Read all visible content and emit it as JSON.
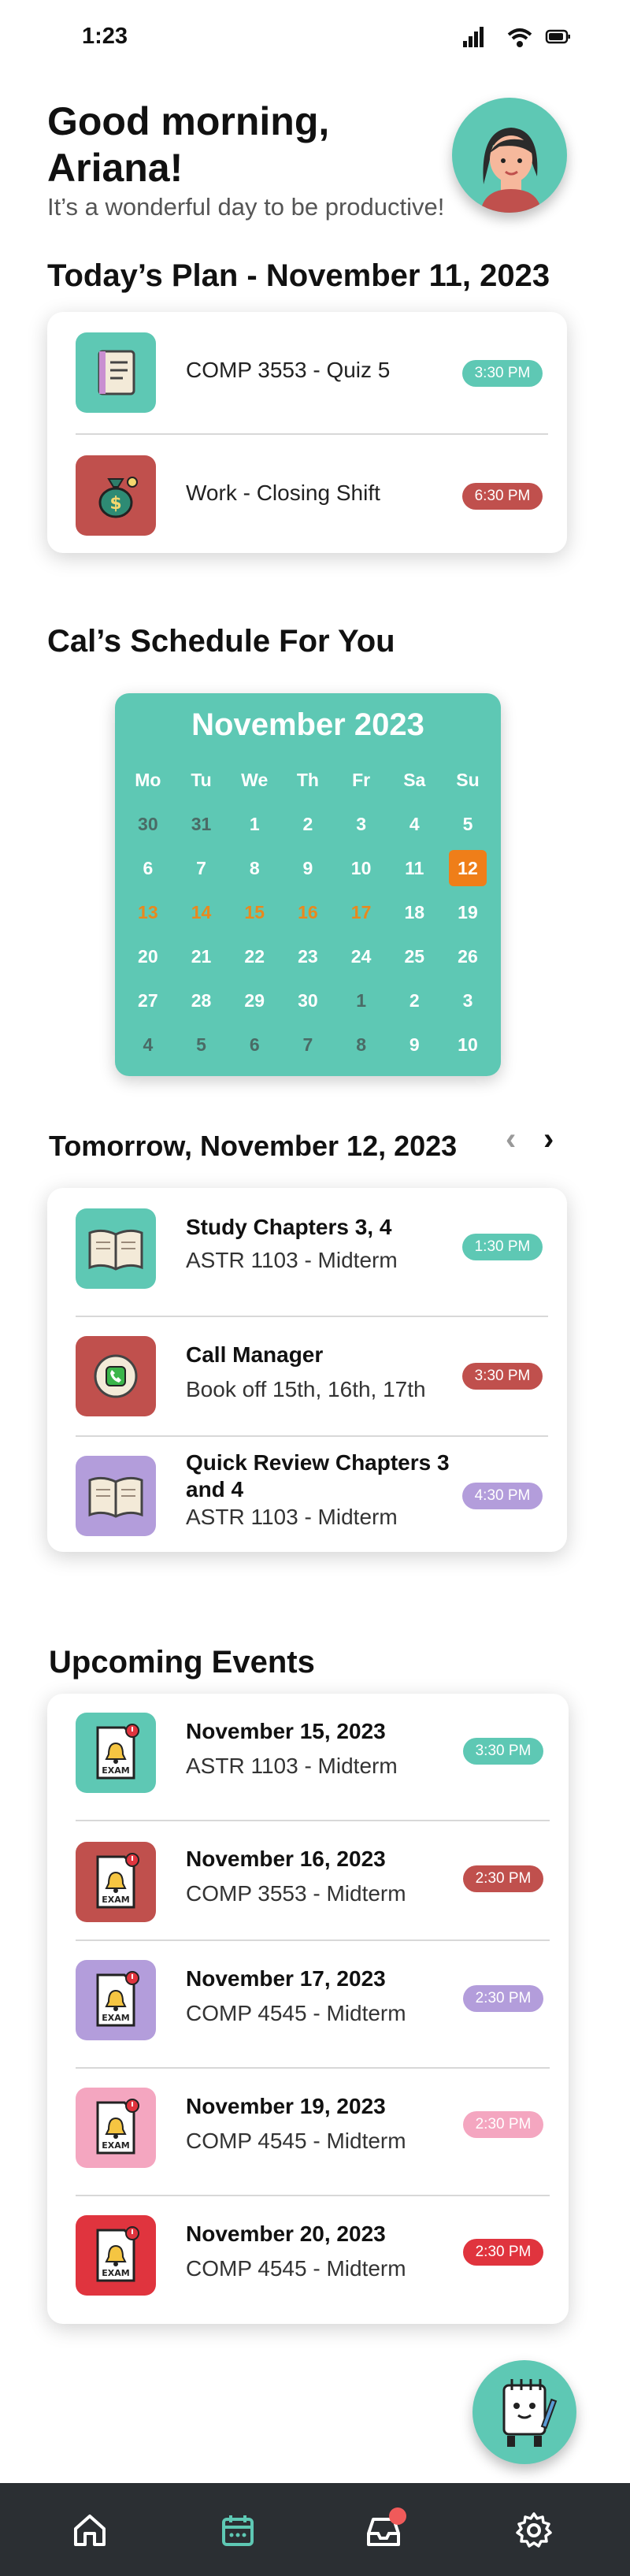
{
  "status": {
    "time": "1:23"
  },
  "greeting": {
    "title": "Good morning, Ariana!",
    "subtitle": "It’s a wonderful day to be productive!"
  },
  "today": {
    "heading": "Today’s Plan - November 11, 2023",
    "items": [
      {
        "label": "COMP 3553 - Quiz 5",
        "time": "3:30 PM",
        "color": "#5ec8b4",
        "icon": "notebook-icon"
      },
      {
        "label": "Work - Closing Shift",
        "time": "6:30 PM",
        "color": "#c0504d",
        "icon": "money-bag-icon"
      }
    ]
  },
  "calendar": {
    "heading": "Cal’s Schedule For You",
    "month": "November 2023",
    "days": [
      "Mo",
      "Tu",
      "We",
      "Th",
      "Fr",
      "Sa",
      "Su"
    ],
    "weeks": [
      [
        {
          "d": "30",
          "s": "muted"
        },
        {
          "d": "31",
          "s": "muted"
        },
        {
          "d": "1",
          "s": ""
        },
        {
          "d": "2",
          "s": ""
        },
        {
          "d": "3",
          "s": ""
        },
        {
          "d": "4",
          "s": ""
        },
        {
          "d": "5",
          "s": ""
        }
      ],
      [
        {
          "d": "6",
          "s": ""
        },
        {
          "d": "7",
          "s": ""
        },
        {
          "d": "8",
          "s": ""
        },
        {
          "d": "9",
          "s": ""
        },
        {
          "d": "10",
          "s": ""
        },
        {
          "d": "11",
          "s": ""
        },
        {
          "d": "12",
          "s": "today"
        }
      ],
      [
        {
          "d": "13",
          "s": "orange"
        },
        {
          "d": "14",
          "s": "orange"
        },
        {
          "d": "15",
          "s": "orange"
        },
        {
          "d": "16",
          "s": "orange"
        },
        {
          "d": "17",
          "s": "orange"
        },
        {
          "d": "18",
          "s": ""
        },
        {
          "d": "19",
          "s": ""
        }
      ],
      [
        {
          "d": "20",
          "s": ""
        },
        {
          "d": "21",
          "s": ""
        },
        {
          "d": "22",
          "s": ""
        },
        {
          "d": "23",
          "s": ""
        },
        {
          "d": "24",
          "s": ""
        },
        {
          "d": "25",
          "s": ""
        },
        {
          "d": "26",
          "s": ""
        }
      ],
      [
        {
          "d": "27",
          "s": ""
        },
        {
          "d": "28",
          "s": ""
        },
        {
          "d": "29",
          "s": ""
        },
        {
          "d": "30",
          "s": ""
        },
        {
          "d": "1",
          "s": "muted"
        },
        {
          "d": "2",
          "s": ""
        },
        {
          "d": "3",
          "s": ""
        }
      ],
      [
        {
          "d": "4",
          "s": "muted"
        },
        {
          "d": "5",
          "s": "muted"
        },
        {
          "d": "6",
          "s": "muted"
        },
        {
          "d": "7",
          "s": "muted"
        },
        {
          "d": "8",
          "s": "muted"
        },
        {
          "d": "9",
          "s": ""
        },
        {
          "d": "10",
          "s": ""
        }
      ]
    ],
    "colors": {
      "bg": "#5ec8b4",
      "today": "#ef7e19",
      "highlight": "#e8891e"
    }
  },
  "tomorrow": {
    "heading": "Tomorrow, November 12, 2023",
    "prev": "‹",
    "next": "›",
    "items": [
      {
        "title": "Study Chapters 3, 4",
        "sub": "ASTR 1103 - Midterm",
        "time": "1:30 PM",
        "color": "#5ec8b4",
        "icon": "open-book-icon"
      },
      {
        "title": "Call Manager",
        "sub": "Book off 15th, 16th, 17th",
        "time": "3:30 PM",
        "color": "#c0504d",
        "icon": "phone-icon"
      },
      {
        "title": "Quick Review Chapters 3 and 4",
        "sub": "ASTR 1103 - Midterm",
        "time": "4:30 PM",
        "color": "#b39ddb",
        "icon": "open-book-icon"
      }
    ]
  },
  "upcoming": {
    "heading": "Upcoming Events",
    "items": [
      {
        "date": "November 15, 2023",
        "sub": "ASTR 1103 - Midterm",
        "time": "3:30 PM",
        "color": "#5ec8b4",
        "badge": "EXAM"
      },
      {
        "date": "November 16, 2023",
        "sub": "COMP 3553 - Midterm",
        "time": "2:30 PM",
        "color": "#c0504d",
        "badge": "EXAM"
      },
      {
        "date": "November 17, 2023",
        "sub": "COMP 4545 - Midterm",
        "time": "2:30 PM",
        "color": "#b39ddb",
        "badge": "EXAM"
      },
      {
        "date": "November 19, 2023",
        "sub": "COMP 4545 - Midterm",
        "time": "2:30 PM",
        "color": "#f4a6c0",
        "badge": "EXAM"
      },
      {
        "date": "November 20, 2023",
        "sub": "COMP 4545 - Midterm",
        "time": "2:30 PM",
        "color": "#e0343e",
        "badge": "EXAM"
      }
    ]
  },
  "nav": {
    "items": [
      {
        "icon": "home-icon"
      },
      {
        "icon": "calendar-icon"
      },
      {
        "icon": "inbox-icon"
      },
      {
        "icon": "settings-icon"
      }
    ],
    "active": 1,
    "colors": {
      "bg": "#2b2f33",
      "active": "#5ec8b4",
      "icon": "#ffffff",
      "badge": "#f05a5a"
    }
  }
}
